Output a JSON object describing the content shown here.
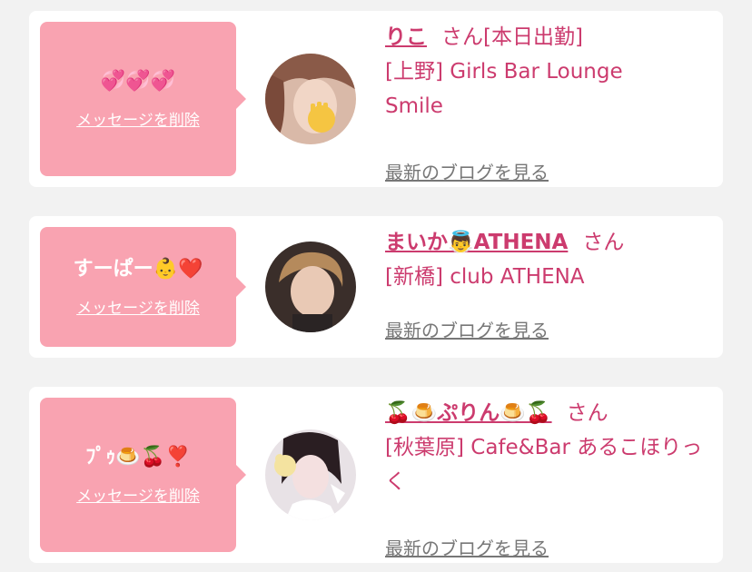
{
  "cards": [
    {
      "message": "💞💞💞",
      "delete_label": "メッセージを削除",
      "name": "りこ",
      "honorific": "さん[本日出勤]",
      "shop": "[上野] Girls Bar Lounge Smile",
      "blog_link": "最新のブログを見る"
    },
    {
      "message": "すーぱー👶❤️",
      "delete_label": "メッセージを削除",
      "name": "まいか👼ATHENA",
      "honorific": "さん",
      "shop": "[新橋] club ATHENA",
      "blog_link": "最新のブログを見る"
    },
    {
      "message": "ﾌﾟｩ🍮🍒❣️",
      "delete_label": "メッセージを削除",
      "name": "🍒🍮ぷりん🍮🍒",
      "honorific": "さん",
      "shop": "[秋葉原] Cafe&Bar あるこほりっく",
      "blog_link": "最新のブログを見る"
    }
  ],
  "colors": {
    "background": "#f2f2f2",
    "card": "#ffffff",
    "bubble": "#f9a3b1",
    "accent": "#cc3b6e",
    "link_gray": "#777777"
  }
}
